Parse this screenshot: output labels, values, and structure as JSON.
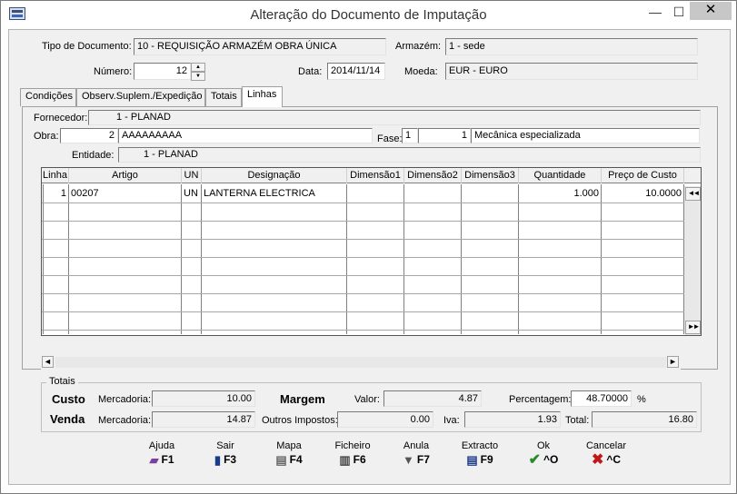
{
  "window": {
    "title": "Alteração do Documento de Imputação",
    "min_glyph": "—",
    "max_glyph": "☐",
    "close_glyph": "✕"
  },
  "header": {
    "tipo_doc_label": "Tipo de Documento:",
    "tipo_doc_value": "10 - REQUISIÇÃO ARMAZÉM OBRA ÚNICA",
    "armazem_label": "Armazém:",
    "armazem_value": "1 - sede",
    "numero_label": "Número:",
    "numero_value": "12",
    "data_label": "Data:",
    "data_value": "2014/11/14",
    "moeda_label": "Moeda:",
    "moeda_value": "EUR - EURO"
  },
  "tabs": [
    {
      "label": "Condições"
    },
    {
      "label": "Observ.Suplem./Expedição"
    },
    {
      "label": "Totais"
    },
    {
      "label": "Linhas"
    }
  ],
  "linhas": {
    "fornecedor_label": "Fornecedor:",
    "fornecedor_value": "1 - PLANAD",
    "obra_label": "Obra:",
    "obra_code": "2",
    "obra_name": "AAAAAAAAA",
    "fase_label": "Fase:",
    "fase_code1": "1",
    "fase_code2": "1",
    "fase_name": "Mecânica especializada",
    "entidade_label": "Entidade:",
    "entidade_value": "1 - PLANAD"
  },
  "grid": {
    "columns": [
      "Linha",
      "Artigo",
      "UN",
      "Designação",
      "Dimensão1",
      "Dimensão2",
      "Dimensão3",
      "Quantidade",
      "Preço de Custo"
    ],
    "rows": [
      {
        "linha": "1",
        "artigo": "00207",
        "un": "UN",
        "designacao": "LANTERNA ELECTRICA",
        "dim1": "",
        "dim2": "",
        "dim3": "",
        "quantidade": "1.000",
        "preco": "10.0000"
      }
    ],
    "scroll_up_glyph": "◄◄",
    "scroll_down_glyph": "►►",
    "scroll_left_glyph": "◄",
    "scroll_right_glyph": "►"
  },
  "totais": {
    "legend": "Totais",
    "custo_label": "Custo",
    "venda_label": "Venda",
    "margem_label": "Margem",
    "mercadoria_label": "Mercadoria:",
    "custo_mercadoria": "10.00",
    "venda_mercadoria": "14.87",
    "valor_label": "Valor:",
    "valor_value": "4.87",
    "percentagem_label": "Percentagem:",
    "percentagem_value": "48.70000",
    "percent_sign": "%",
    "outros_impostos_label": "Outros Impostos:",
    "outros_impostos_value": "0.00",
    "iva_label": "Iva:",
    "iva_value": "1.93",
    "total_label": "Total:",
    "total_value": "16.80"
  },
  "function_keys": [
    {
      "label": "Ajuda",
      "key": "F1",
      "icon": "help-book-icon"
    },
    {
      "label": "Sair",
      "key": "F3",
      "icon": "exit-icon"
    },
    {
      "label": "Mapa",
      "key": "F4",
      "icon": "printer-icon"
    },
    {
      "label": "Ficheiro",
      "key": "F6",
      "icon": "file-cabinet-icon"
    },
    {
      "label": "Anula",
      "key": "F7",
      "icon": "trash-icon"
    },
    {
      "label": "Extracto",
      "key": "F9",
      "icon": "document-icon"
    },
    {
      "label": "Ok",
      "key": "^O",
      "icon": "checkmark-icon",
      "color": "#2a8a2a"
    },
    {
      "label": "Cancelar",
      "key": "^C",
      "icon": "cross-icon",
      "color": "#c01818"
    }
  ]
}
